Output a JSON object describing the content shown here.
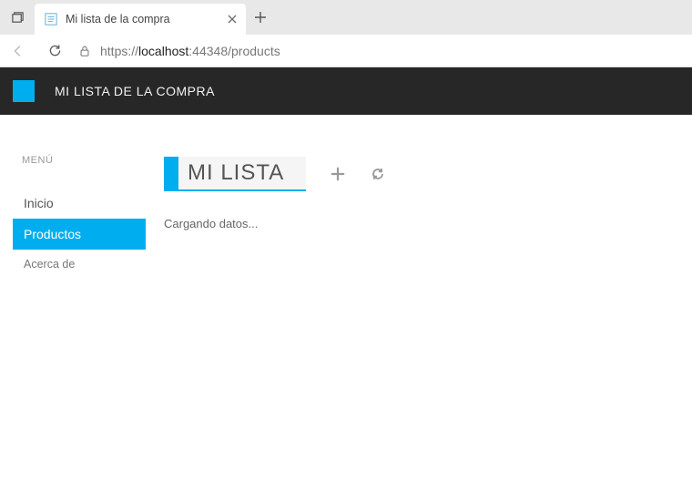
{
  "browser": {
    "tab_title": "Mi lista de la compra",
    "url_prefix": "https://",
    "url_host": "localhost",
    "url_suffix": ":44348/products"
  },
  "header": {
    "brand": "MI LISTA DE LA COMPRA"
  },
  "sidebar": {
    "heading": "MENÚ",
    "items": [
      {
        "label": "Inicio"
      },
      {
        "label": "Productos"
      },
      {
        "label": "Acerca de"
      }
    ]
  },
  "main": {
    "title_value": "MI LISTA",
    "status": "Cargando datos..."
  }
}
